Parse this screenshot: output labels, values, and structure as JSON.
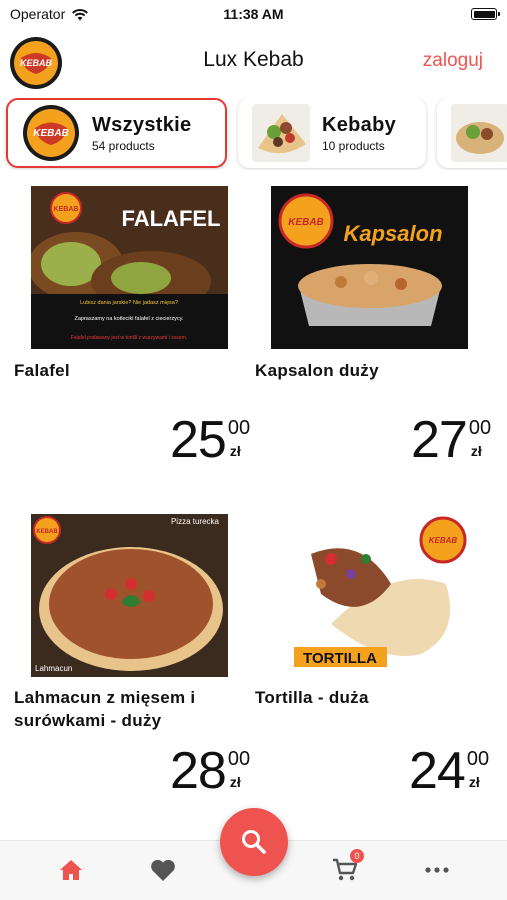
{
  "status_bar": {
    "carrier": "Operator",
    "time": "11:38 AM"
  },
  "header": {
    "logo_text": "KEBAB",
    "title": "Lux Kebab",
    "login_label": "zaloguj"
  },
  "categories": [
    {
      "name": "Wszystkie",
      "count": "54 products",
      "active": true
    },
    {
      "name": "Kebaby",
      "count": "10 products",
      "active": false
    }
  ],
  "products": [
    {
      "name": "Falafel",
      "price_main": "25",
      "price_cents": "00",
      "currency": "zł",
      "image": {
        "logo": "KEBAB",
        "headline": "FALAFEL",
        "line1": "Lubisz dania jarskie? Nie jadasz mięsa?",
        "line2": "Zapraszamy na kotleciki falafel z ciecierzycy.",
        "line3": "Falafel podawany jest w tortilli z warzywami i sosem."
      }
    },
    {
      "name": "Kapsalon duży",
      "price_main": "27",
      "price_cents": "00",
      "currency": "zł",
      "image": {
        "logo": "KEBAB",
        "headline": "Kapsalon"
      }
    },
    {
      "name": "Lahmacun z mięsem i surówkami - duży",
      "price_main": "28",
      "price_cents": "00",
      "currency": "zł",
      "image": {
        "logo": "KEBAB",
        "tag_top": "Pizza turecka",
        "tag_bottom": "Lahmacun"
      }
    },
    {
      "name": "Tortilla - duża",
      "price_main": "24",
      "price_cents": "00",
      "currency": "zł",
      "image": {
        "logo": "KEBAB",
        "label": "TORTILLA"
      }
    }
  ],
  "bottom_nav": {
    "items": [
      "home-icon",
      "heart-icon",
      "search-icon",
      "cart-icon",
      "more-icon"
    ],
    "cart_count": "0"
  },
  "colors": {
    "accent": "#ef5350",
    "logo_orange": "#f4a21d",
    "logo_red": "#c62828"
  }
}
